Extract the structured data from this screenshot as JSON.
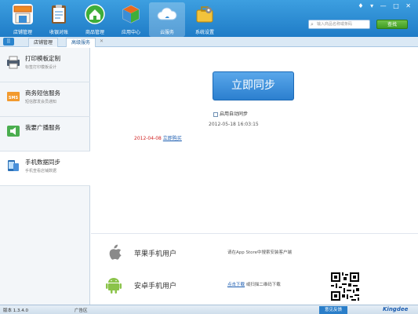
{
  "toolbar": {
    "items": [
      {
        "label": "店铺管理",
        "icon": "store-icon",
        "color": "#f08a24"
      },
      {
        "label": "收银对账",
        "icon": "clipboard-icon",
        "color": "#3b8ed6"
      },
      {
        "label": "商品管理",
        "icon": "home-icon",
        "color": "#3fae3a"
      },
      {
        "label": "应用中心",
        "icon": "apps-icon",
        "color": "#e86a1e"
      },
      {
        "label": "云服务",
        "icon": "cloud-icon",
        "color": "#4aa7e6"
      },
      {
        "label": "系统设置",
        "icon": "briefcase-icon",
        "color": "#f2c33b"
      }
    ],
    "window_controls": "♦ ▾ — □ ✕",
    "search_placeholder": "输入商品名称或条码",
    "search_button": "查找"
  },
  "tabs": [
    {
      "label": "店铺管理",
      "active": false
    },
    {
      "label": "高级服务",
      "active": true
    }
  ],
  "sidebar": {
    "items": [
      {
        "title": "打印模板定制",
        "desc": "标签打印模板设计",
        "icon": "printer-icon",
        "active": false
      },
      {
        "title": "商务短信服务",
        "desc": "短信群发会员通知",
        "icon": "sms-icon",
        "active": false
      },
      {
        "title": "我要广播服务",
        "desc": "",
        "icon": "broadcast-icon",
        "active": false
      },
      {
        "title": "手机数据同步",
        "desc": "手机查看店铺数据",
        "icon": "phone-icon",
        "active": true
      }
    ]
  },
  "main": {
    "sync_button": "立即同步",
    "auto_sync_label": "启用自动同步",
    "last_sync": "2012-05-18 16:03:15",
    "expire_msg": "2012-04-08",
    "expire_link": "立即购买",
    "platforms": [
      {
        "name": "苹果手机用户",
        "icon": "apple-icon",
        "desc": "请在App Store中搜索安装客户端",
        "link": ""
      },
      {
        "name": "安卓手机用户",
        "icon": "android-icon",
        "desc": "或扫描二维码下载",
        "link": "点击下载"
      }
    ]
  },
  "statusbar": {
    "version": "版本 1.3.4.0",
    "ad": "广告区",
    "feedback": "意见反馈",
    "logo": "Kingdee"
  }
}
